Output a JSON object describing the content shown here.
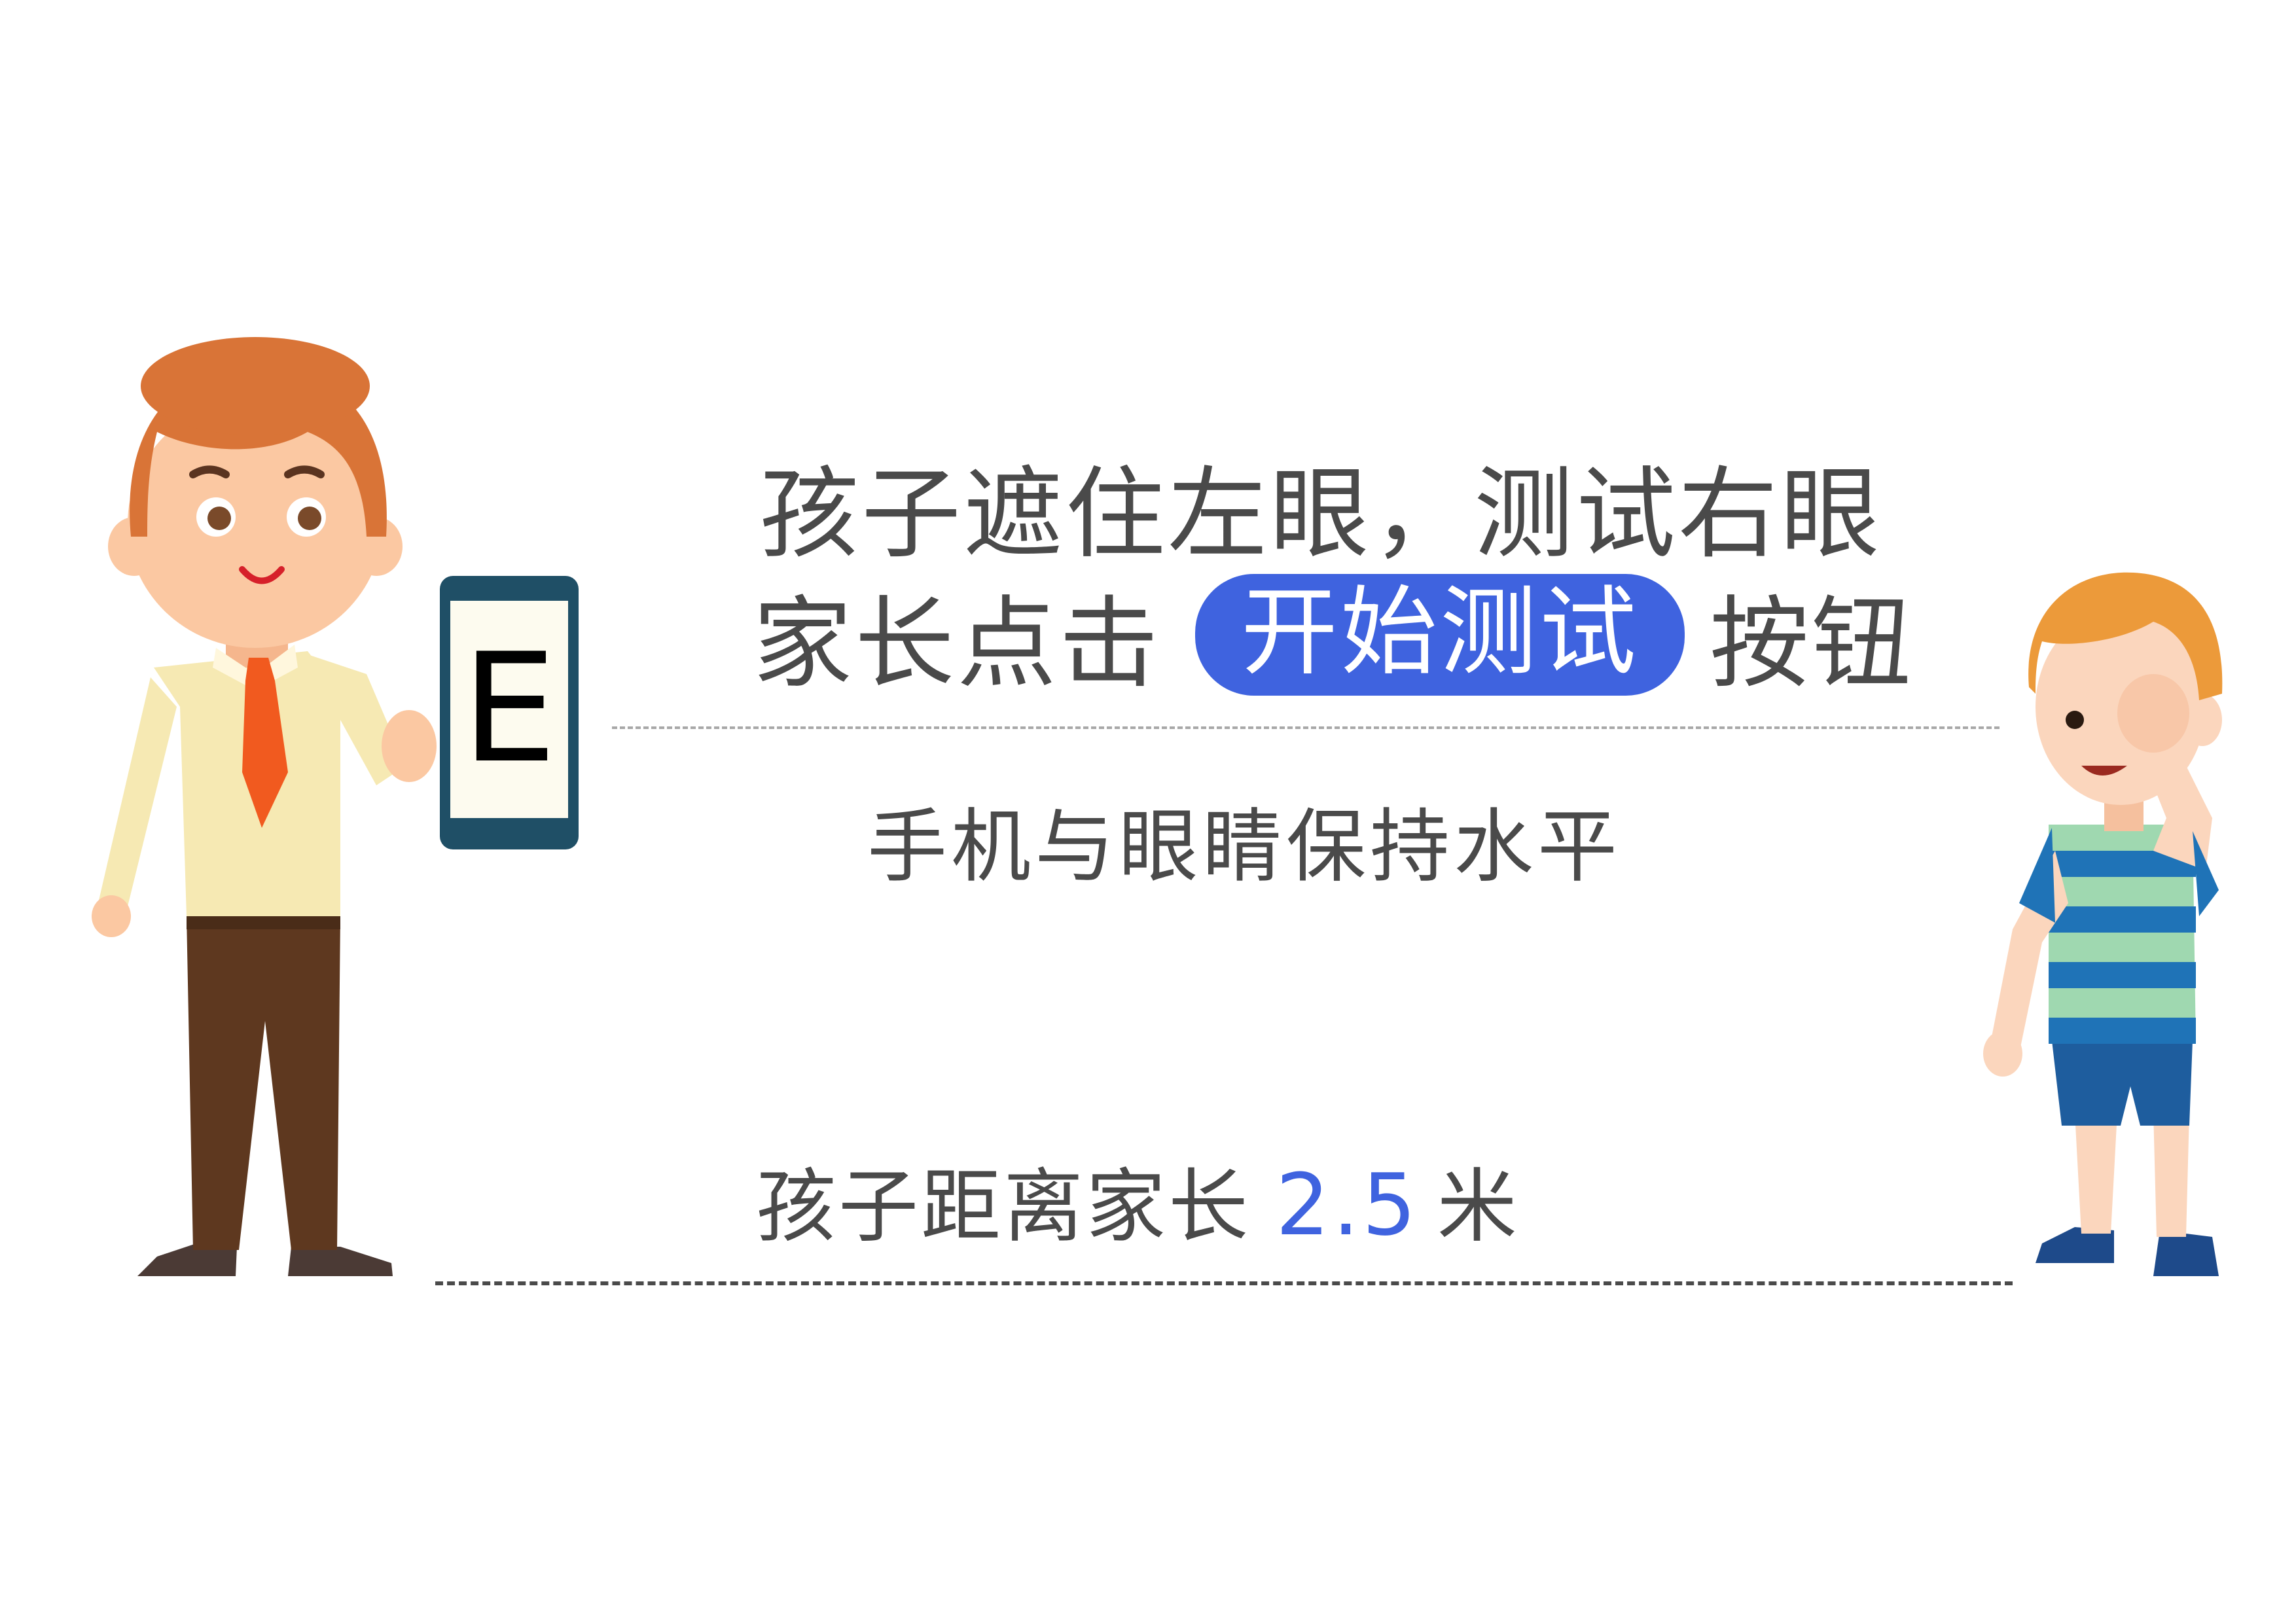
{
  "instructions": {
    "line1": "孩子遮住左眼，测试右眼",
    "line2_prefix": "家长点击",
    "button_label": "开始测试",
    "line2_suffix": "按钮",
    "level_text": "手机与眼睛保持水平",
    "distance_prefix": "孩子距离家长",
    "distance_value": "2.5",
    "distance_unit": "米"
  },
  "phone": {
    "chart_letter": "E"
  },
  "colors": {
    "accent": "#3f63df",
    "text": "#4a4a4a",
    "adult_hair": "#d97437",
    "adult_shirt": "#f6e9b3",
    "adult_tie": "#f15a1f",
    "adult_pants": "#5e381f",
    "child_shirt_stripe_blue": "#1f73b7",
    "child_shirt_stripe_green": "#9fd8b0"
  },
  "icons": [
    "adult-figure",
    "child-figure",
    "phone-icon"
  ]
}
